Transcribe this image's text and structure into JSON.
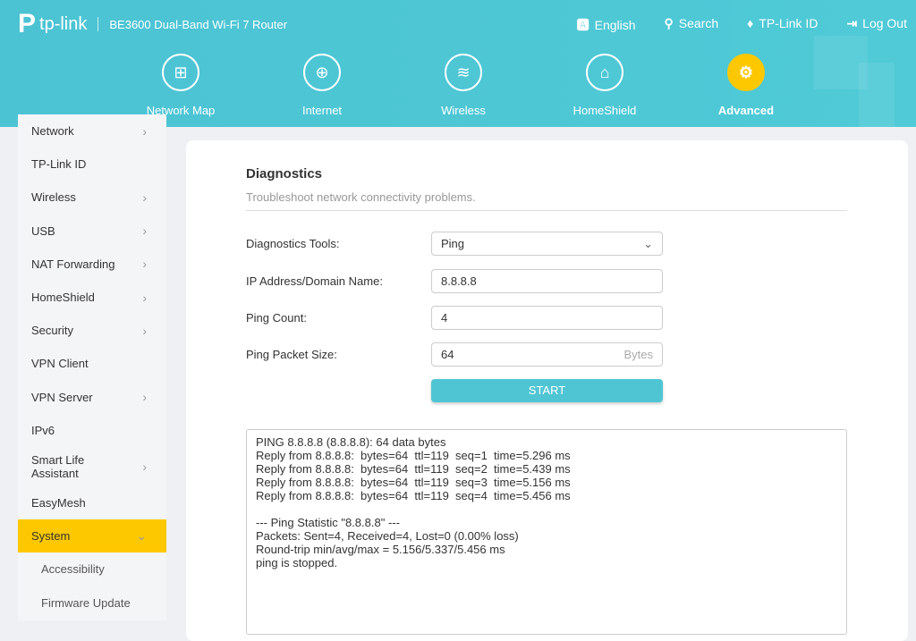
{
  "header": {
    "brand": "tp-link",
    "model": "BE3600 Dual-Band Wi-Fi 7 Router",
    "links": [
      {
        "icon": "language-icon",
        "label": "English"
      },
      {
        "icon": "search-icon",
        "label": "Search"
      },
      {
        "icon": "tplink-id-icon",
        "label": "TP-Link ID"
      },
      {
        "icon": "logout-icon",
        "label": "Log Out"
      }
    ]
  },
  "nav": [
    {
      "label": "Network Map"
    },
    {
      "label": "Internet"
    },
    {
      "label": "Wireless"
    },
    {
      "label": "HomeShield"
    },
    {
      "label": "Advanced",
      "active": true
    }
  ],
  "sidebar": [
    {
      "label": "Network",
      "chevron": true
    },
    {
      "label": "TP-Link ID"
    },
    {
      "label": "Wireless",
      "chevron": true
    },
    {
      "label": "USB",
      "chevron": true
    },
    {
      "label": "NAT Forwarding",
      "chevron": true
    },
    {
      "label": "HomeShield",
      "chevron": true
    },
    {
      "label": "Security",
      "chevron": true
    },
    {
      "label": "VPN Client"
    },
    {
      "label": "VPN Server",
      "chevron": true
    },
    {
      "label": "IPv6"
    },
    {
      "label": "Smart Life Assistant",
      "chevron": true
    },
    {
      "label": "EasyMesh"
    },
    {
      "label": "System",
      "active": true,
      "expanded": true
    },
    {
      "label": "Accessibility",
      "sub": true
    },
    {
      "label": "Firmware Update",
      "sub": true
    }
  ],
  "main": {
    "title": "Diagnostics",
    "subtitle": "Troubleshoot network connectivity problems.",
    "tools_label": "Diagnostics Tools:",
    "tools_value": "Ping",
    "ip_label": "IP Address/Domain Name:",
    "ip_value": "8.8.8.8",
    "count_label": "Ping Count:",
    "count_value": "4",
    "size_label": "Ping Packet Size:",
    "size_value": "64",
    "size_unit": "Bytes",
    "start_label": "START",
    "output": "PING 8.8.8.8 (8.8.8.8): 64 data bytes\nReply from 8.8.8.8:  bytes=64  ttl=119  seq=1  time=5.296 ms\nReply from 8.8.8.8:  bytes=64  ttl=119  seq=2  time=5.439 ms\nReply from 8.8.8.8:  bytes=64  ttl=119  seq=3  time=5.156 ms\nReply from 8.8.8.8:  bytes=64  ttl=119  seq=4  time=5.456 ms\n\n--- Ping Statistic \"8.8.8.8\" ---\nPackets: Sent=4, Received=4, Lost=0 (0.00% loss)\nRound-trip min/avg/max = 5.156/5.337/5.456 ms\nping is stopped."
  }
}
